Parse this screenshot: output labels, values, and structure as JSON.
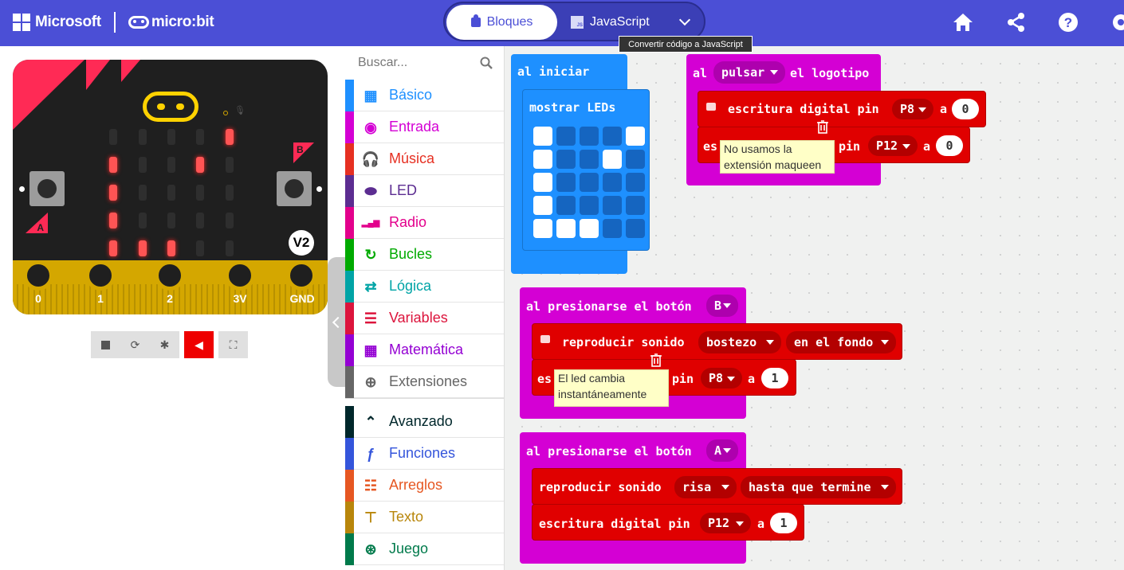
{
  "header": {
    "brand_microsoft": "Microsoft",
    "brand_microbit": "micro:bit",
    "tab_blocks": "Bloques",
    "tab_js": "JavaScript",
    "tooltip": "Convertir código a JavaScript",
    "icons": [
      "home-icon",
      "share-icon",
      "help-icon",
      "settings-icon"
    ],
    "accent": "#4b4fd6"
  },
  "simulator": {
    "leds": [
      [
        0,
        0,
        0,
        0,
        1
      ],
      [
        1,
        0,
        0,
        1,
        0
      ],
      [
        1,
        0,
        0,
        0,
        0
      ],
      [
        1,
        0,
        0,
        0,
        0
      ],
      [
        1,
        1,
        1,
        0,
        0
      ]
    ],
    "button_a": "A",
    "button_b": "B",
    "version": "V2",
    "pins": [
      "0",
      "1",
      "2",
      "3V",
      "GND"
    ],
    "controls": [
      "stop-icon",
      "restart-icon",
      "debug-icon",
      "sound-icon",
      "fullscreen-icon"
    ]
  },
  "toolbox": {
    "search_placeholder": "Buscar...",
    "categories": [
      {
        "label": "Básico",
        "color": "#1e90ff",
        "icon": "grid-icon"
      },
      {
        "label": "Entrada",
        "color": "#d400d4",
        "icon": "input-icon"
      },
      {
        "label": "Música",
        "color": "#e63022",
        "icon": "headphones-icon"
      },
      {
        "label": "LED",
        "color": "#5c2d91",
        "icon": "toggle-icon"
      },
      {
        "label": "Radio",
        "color": "#e3008c",
        "icon": "signal-icon"
      },
      {
        "label": "Bucles",
        "color": "#00aa00",
        "icon": "loop-icon"
      },
      {
        "label": "Lógica",
        "color": "#00a4a6",
        "icon": "logic-icon"
      },
      {
        "label": "Variables",
        "color": "#dc143c",
        "icon": "list-icon"
      },
      {
        "label": "Matemática",
        "color": "#9400d3",
        "icon": "calculator-icon"
      },
      {
        "label": "Extensiones",
        "color": "#666666",
        "icon": "plus-icon"
      },
      {
        "label": "Avanzado",
        "color": "#00272b",
        "icon": "chevron-up-icon"
      },
      {
        "label": "Funciones",
        "color": "#3455db",
        "icon": "function-icon"
      },
      {
        "label": "Arreglos",
        "color": "#e65722",
        "icon": "array-icon"
      },
      {
        "label": "Texto",
        "color": "#b8860b",
        "icon": "text-icon"
      },
      {
        "label": "Juego",
        "color": "#007a4b",
        "icon": "gamepad-icon"
      }
    ]
  },
  "workspace": {
    "on_start": {
      "label": "al iniciar",
      "show_leds": "mostrar LEDs",
      "grid": [
        [
          1,
          0,
          0,
          0,
          1
        ],
        [
          1,
          0,
          0,
          1,
          0
        ],
        [
          1,
          0,
          0,
          0,
          0
        ],
        [
          1,
          0,
          0,
          0,
          0
        ],
        [
          1,
          1,
          1,
          0,
          0
        ]
      ]
    },
    "logo": {
      "al": "al",
      "event": "pulsar",
      "tail": "el logotipo",
      "write1": "escritura digital pin",
      "pin1": "P8",
      "a1": "a",
      "val1": "0",
      "write2_prefix": "es",
      "write2_suffix": "pin",
      "pin2": "P12",
      "a2": "a",
      "val2": "0",
      "comment": "No usamos la extensión maqueen"
    },
    "button_b": {
      "label": "al presionarse el botón",
      "button": "B",
      "play": "reproducir sonido",
      "sound": "bostezo",
      "mode": "en el fondo",
      "write_prefix": "es",
      "write_suffix": "pin",
      "pin": "P8",
      "a": "a",
      "val": "1",
      "comment": "El led cambia instantáneamente"
    },
    "button_a": {
      "label": "al presionarse el botón",
      "button": "A",
      "play": "reproducir sonido",
      "sound": "risa",
      "mode": "hasta que termine",
      "write": "escritura digital pin",
      "pin": "P12",
      "a": "a",
      "val": "1"
    }
  }
}
